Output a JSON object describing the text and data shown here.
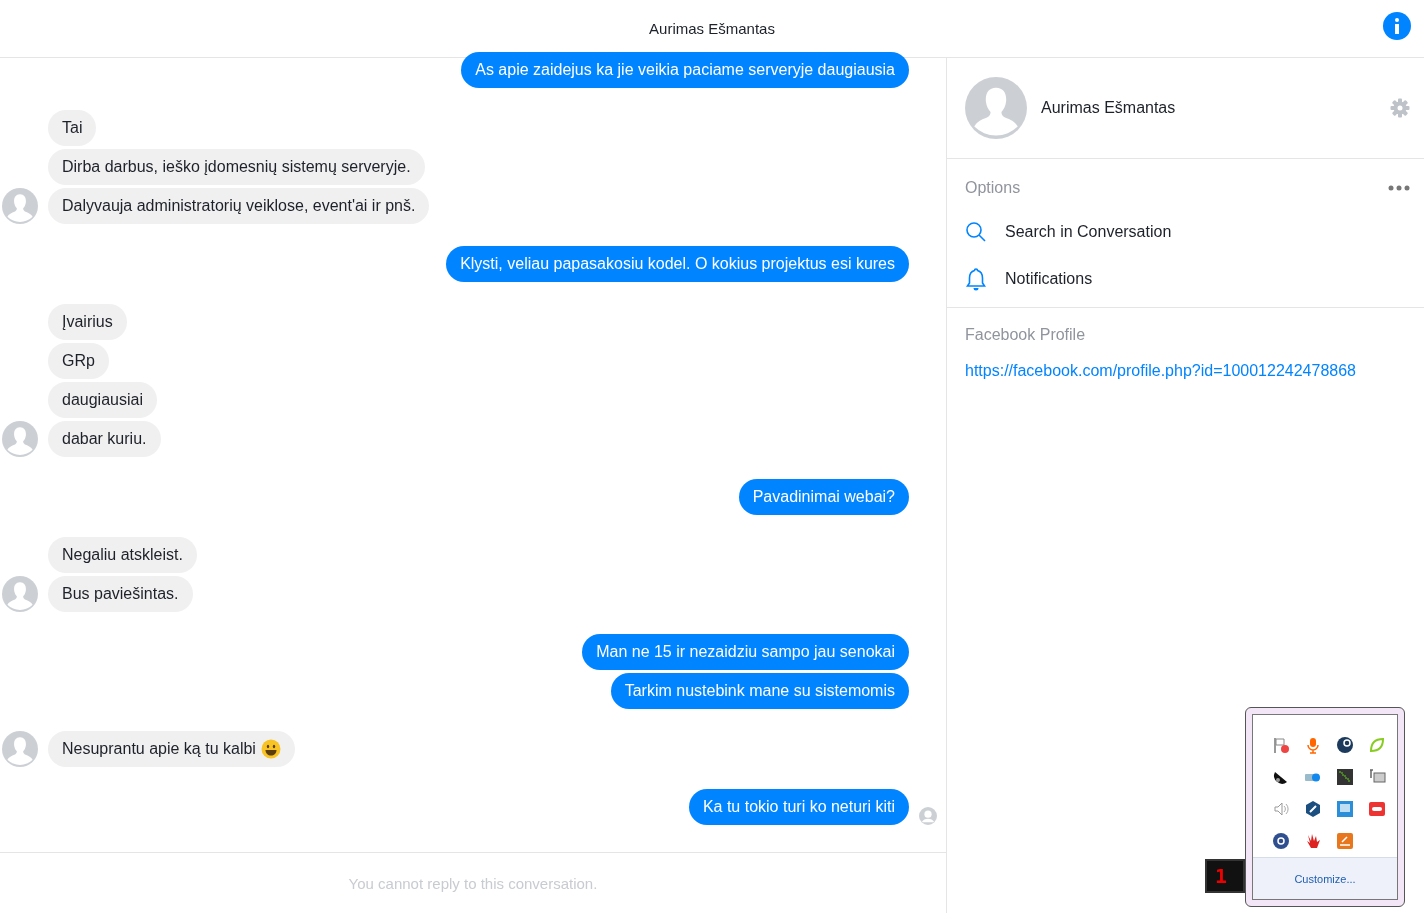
{
  "header": {
    "title": "Aurimas Ešmantas"
  },
  "groups": [
    {
      "kind": "outgoing",
      "messages": [
        "As apie zaidejus ka jie veikia paciame serveryje daugiausia"
      ]
    },
    {
      "kind": "incoming",
      "messages": [
        "Tai",
        "Dirba darbus, ieško įdomesnių sistemų serveryje.",
        "Dalyvauja administratorių veiklose, event'ai ir pnš."
      ]
    },
    {
      "kind": "outgoing",
      "messages": [
        "Klysti, veliau papasakosiu kodel. O kokius projektus esi kures"
      ]
    },
    {
      "kind": "incoming",
      "messages": [
        "Įvairius",
        "GRp",
        "daugiausiai",
        "dabar kuriu."
      ]
    },
    {
      "kind": "outgoing",
      "messages": [
        "Pavadinimai webai?"
      ]
    },
    {
      "kind": "incoming",
      "messages": [
        "Negaliu atskleist.",
        "Bus paviešintas."
      ]
    },
    {
      "kind": "outgoing",
      "messages": [
        "Man ne 15 ir nezaidziu sampo jau senokai",
        "Tarkim nustebink mane su sistemomis"
      ]
    },
    {
      "kind": "incoming",
      "messages": [
        "Nesuprantu apie ką tu kalbi"
      ],
      "emoji": true
    },
    {
      "kind": "outgoing",
      "messages": [
        "Ka tu tokio turi ko neturi kiti"
      ],
      "seen": true
    }
  ],
  "composer": {
    "notice": "You cannot reply to this conversation."
  },
  "sidebar": {
    "name": "Aurimas Ešmantas",
    "options_title": "Options",
    "options": [
      {
        "kind": "search",
        "label": "Search in Conversation"
      },
      {
        "kind": "notifications",
        "label": "Notifications"
      }
    ],
    "profile_title": "Facebook Profile",
    "profile_link": "https://facebook.com/profile.php?id=100012242478868"
  },
  "tray": {
    "clock_digit": "1",
    "customize": "Customize..."
  }
}
